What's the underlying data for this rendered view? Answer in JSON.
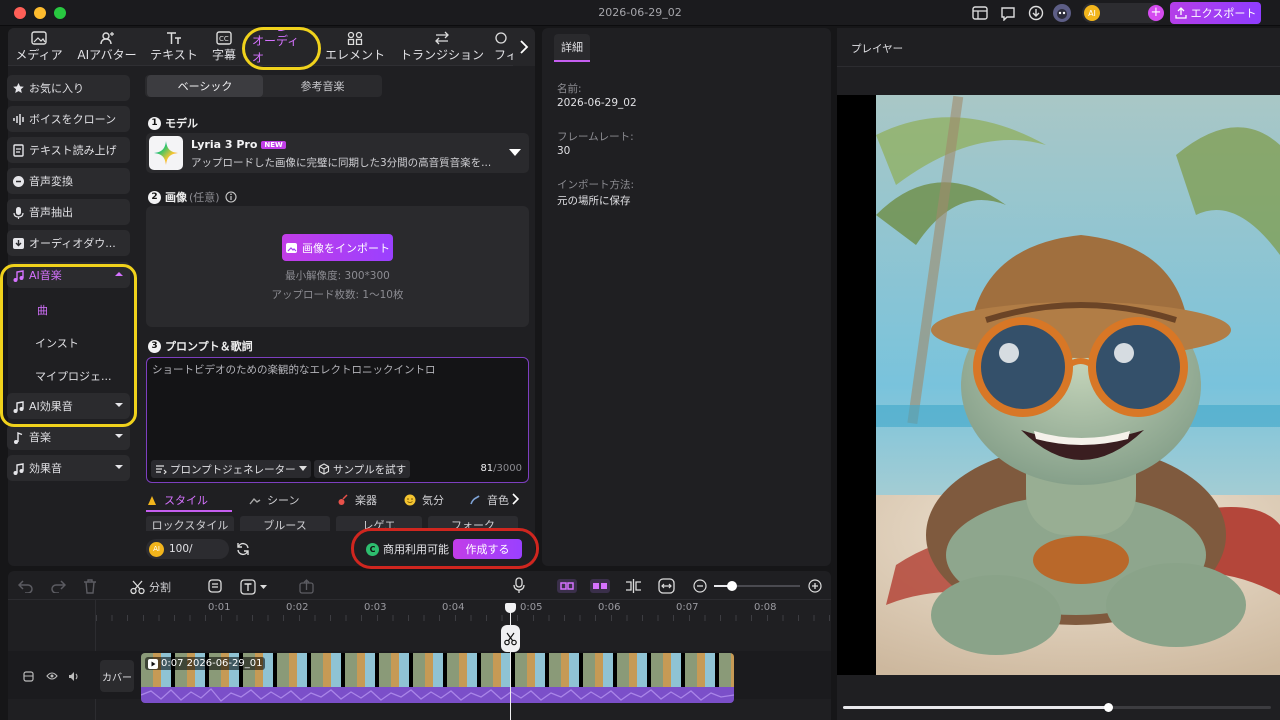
{
  "window": {
    "title": "2026-06-29_02",
    "export_label": "エクスポート"
  },
  "top_tabs": [
    {
      "label": "メディア"
    },
    {
      "label": "AIアバター"
    },
    {
      "label": "テキスト"
    },
    {
      "label": "字幕"
    },
    {
      "label": "オーディオ"
    },
    {
      "label": "エレメント"
    },
    {
      "label": "トランジション"
    },
    {
      "label": "フィ"
    }
  ],
  "sidebar": {
    "items": [
      {
        "label": "お気に入り"
      },
      {
        "label": "ボイスをクローン"
      },
      {
        "label": "テキスト読み上げ"
      },
      {
        "label": "音声変換"
      },
      {
        "label": "音声抽出"
      },
      {
        "label": "オーディオダウ..."
      },
      {
        "label": "AI音楽"
      },
      {
        "label": "AI効果音"
      },
      {
        "label": "音楽"
      },
      {
        "label": "効果音"
      }
    ],
    "subitems": [
      {
        "label": "曲"
      },
      {
        "label": "インスト"
      },
      {
        "label": "マイプロジェ..."
      }
    ]
  },
  "content": {
    "segments": [
      "ベーシック",
      "参考音楽"
    ],
    "model_section": "モデル",
    "model": {
      "name": "Lyria 3 Pro",
      "badge": "NEW",
      "description": "アップロードした画像に完璧に同期した3分間の高音質音楽を..."
    },
    "image_section": "画像",
    "image_optional": "(任意)",
    "import_label": "画像をインポート",
    "min_res": "最小解像度: 300*300",
    "upload_count": "アップロード枚数: 1〜10枚",
    "prompt_section": "プロンプト＆歌詞",
    "prompt_text": "ショートビデオのための楽観的なエレクトロニックイントロ",
    "prompt_gen": "プロンプトジェネレーター",
    "sample": "サンプルを試す",
    "count_used": "81",
    "count_total": "/3000",
    "cat_tabs": [
      "スタイル",
      "シーン",
      "楽器",
      "気分",
      "音色"
    ],
    "chips": [
      "ロックスタイル",
      "ブルース",
      "レゲエ",
      "フォーク"
    ],
    "credits": "100/",
    "commercial": "商用利用可能",
    "create": "作成する"
  },
  "details": {
    "tab": "詳細",
    "name_label": "名前:",
    "name_value": "2026-06-29_02",
    "fps_label": "フレームレート:",
    "fps_value": "30",
    "import_label": "インポート方法:",
    "import_value": "元の場所に保存"
  },
  "player": {
    "title": "プレイヤー",
    "progress": 0.62
  },
  "timeline": {
    "split": "分割",
    "ticks": [
      "0:01",
      "0:02",
      "0:03",
      "0:04",
      "0:05",
      "0:06",
      "0:07",
      "0:08"
    ],
    "cover": "カバー",
    "clip_label": "0:07 2026-06-29_01"
  },
  "colors": {
    "accent": "#b43ee8",
    "highlight_yellow": "#f0d21c",
    "highlight_red": "#d0261f"
  }
}
